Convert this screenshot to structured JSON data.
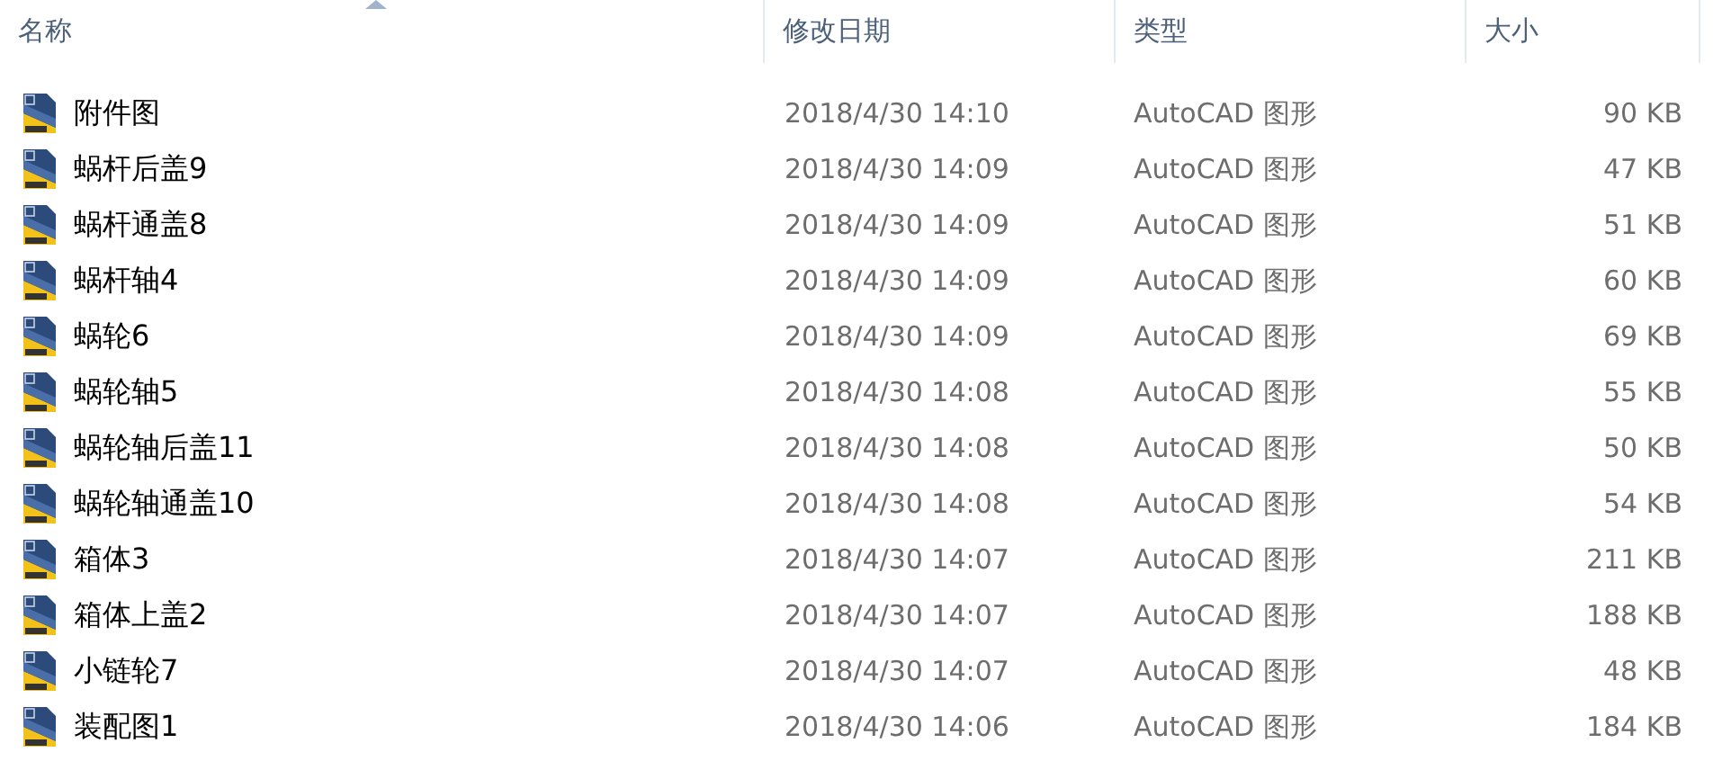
{
  "columns": [
    {
      "label": "名称",
      "sorted": true
    },
    {
      "label": "修改日期",
      "sorted": false
    },
    {
      "label": "类型",
      "sorted": false
    },
    {
      "label": "大小",
      "sorted": false
    }
  ],
  "rows": [
    {
      "name": "附件图",
      "date": "2018/4/30 14:10",
      "type": "AutoCAD 图形",
      "size": "90 KB"
    },
    {
      "name": "蜗杆后盖9",
      "date": "2018/4/30 14:09",
      "type": "AutoCAD 图形",
      "size": "47 KB"
    },
    {
      "name": "蜗杆通盖8",
      "date": "2018/4/30 14:09",
      "type": "AutoCAD 图形",
      "size": "51 KB"
    },
    {
      "name": "蜗杆轴4",
      "date": "2018/4/30 14:09",
      "type": "AutoCAD 图形",
      "size": "60 KB"
    },
    {
      "name": "蜗轮6",
      "date": "2018/4/30 14:09",
      "type": "AutoCAD 图形",
      "size": "69 KB"
    },
    {
      "name": "蜗轮轴5",
      "date": "2018/4/30 14:08",
      "type": "AutoCAD 图形",
      "size": "55 KB"
    },
    {
      "name": "蜗轮轴后盖11",
      "date": "2018/4/30 14:08",
      "type": "AutoCAD 图形",
      "size": "50 KB"
    },
    {
      "name": "蜗轮轴通盖10",
      "date": "2018/4/30 14:08",
      "type": "AutoCAD 图形",
      "size": "54 KB"
    },
    {
      "name": "箱体3",
      "date": "2018/4/30 14:07",
      "type": "AutoCAD 图形",
      "size": "211 KB"
    },
    {
      "name": "箱体上盖2",
      "date": "2018/4/30 14:07",
      "type": "AutoCAD 图形",
      "size": "188 KB"
    },
    {
      "name": "小链轮7",
      "date": "2018/4/30 14:07",
      "type": "AutoCAD 图形",
      "size": "48 KB"
    },
    {
      "name": "装配图1",
      "date": "2018/4/30 14:06",
      "type": "AutoCAD 图形",
      "size": "184 KB"
    }
  ]
}
